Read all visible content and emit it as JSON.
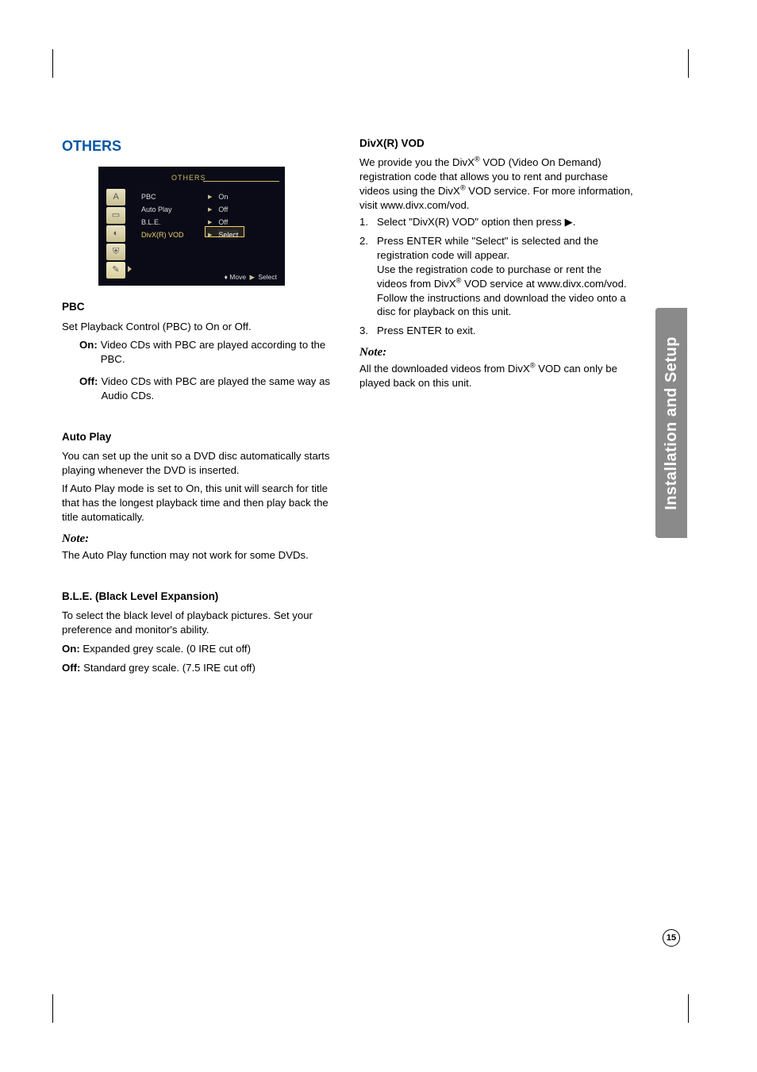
{
  "sidebar": {
    "label": "Installation and Setup"
  },
  "page_number": "15",
  "left": {
    "section_title": "OTHERS",
    "osd": {
      "title": "OTHERS",
      "rows": [
        {
          "label": "PBC",
          "value": "On"
        },
        {
          "label": "Auto Play",
          "value": "Off"
        },
        {
          "label": "B.L.E.",
          "value": "Off"
        },
        {
          "label": "DivX(R) VOD",
          "value": "Select"
        }
      ],
      "footer_move": "Move",
      "footer_select": "Select"
    },
    "pbc": {
      "heading": "PBC",
      "intro": "Set Playback Control (PBC) to On or Off.",
      "on_label": "On:",
      "on_text": "Video CDs with PBC are played according to the PBC.",
      "off_label": "Off:",
      "off_text": "Video CDs with PBC are played the same way as Audio CDs."
    },
    "autoplay": {
      "heading": "Auto Play",
      "p1": "You can set up the unit so a DVD disc automatically starts playing whenever the DVD is inserted.",
      "p2": "If Auto Play mode is set to On, this unit will search for title that has the longest playback time and then play back the title automatically.",
      "note_label": "Note:",
      "note_text": "The Auto Play function may not work for some DVDs."
    },
    "ble": {
      "heading": "B.L.E. (Black Level Expansion)",
      "intro": "To select the black level of playback pictures. Set your preference and monitor's ability.",
      "on_label": "On:",
      "on_text": "Expanded grey scale. (0 IRE cut off)",
      "off_label": "Off:",
      "off_text": "Standard grey scale. (7.5 IRE cut off)"
    }
  },
  "right": {
    "divx": {
      "heading": "DivX(R) VOD",
      "intro_a": "We provide you the DivX",
      "intro_b": " VOD (Video On Demand) registration code that allows you to rent and purchase videos using the DivX",
      "intro_c": " VOD service. For more information, visit www.divx.com/vod.",
      "step1": "Select \"DivX(R) VOD\" option then press ▶.",
      "step2a": "Press ENTER while \"Select\" is selected and the registration code will appear.",
      "step2b_a": "Use the registration code to purchase or rent the videos from DivX",
      "step2b_b": " VOD service at www.divx.com/vod. Follow the instructions and download the video onto a disc for playback on this unit.",
      "step3": "Press ENTER to exit.",
      "note_label": "Note:",
      "note_a": "All the downloaded videos from DivX",
      "note_b": " VOD can only be played back on this unit."
    }
  }
}
